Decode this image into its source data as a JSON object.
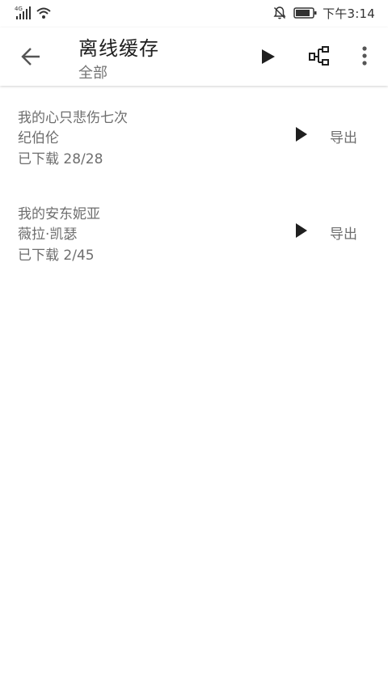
{
  "status_bar": {
    "network": "4G",
    "time": "下午3:14"
  },
  "app_bar": {
    "title": "离线缓存",
    "subtitle": "全部",
    "icons": [
      "back-arrow-icon",
      "play-icon",
      "tree-icon",
      "more-vert-icon"
    ]
  },
  "downloads": [
    {
      "title": "我的心只悲伤七次",
      "artist": "纪伯伦",
      "progress": "已下载 28/28",
      "export_label": "导出"
    },
    {
      "title": "我的安东妮亚",
      "artist": "薇拉·凯瑟",
      "progress": "已下载 2/45",
      "export_label": "导出"
    }
  ],
  "colors": {
    "text_primary": "#1e1e1e",
    "text_secondary": "#6e6e6e",
    "icon": "#1f1f1f",
    "background": "#ffffff"
  }
}
